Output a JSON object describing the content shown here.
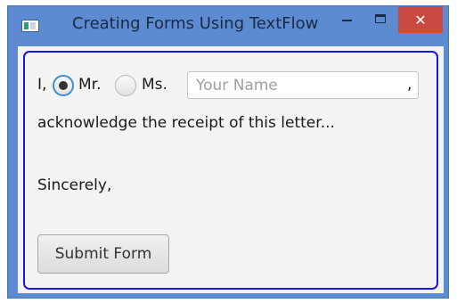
{
  "window": {
    "title": "Creating Forms Using TextFlow",
    "close_label": "✕"
  },
  "form": {
    "prefix": "I,",
    "radio_mr_label": "Mr.",
    "radio_ms_label": "Ms.",
    "selected_option": "Mr.",
    "name_input_value": "",
    "name_input_placeholder": "Your Name",
    "comma": ",",
    "acknowledge_text": "acknowledge the receipt of this letter...",
    "closing_text": "Sincerely,",
    "submit_label": "Submit Form"
  },
  "colors": {
    "titlebar": "#5c8bd1",
    "close_button": "#c94a43",
    "form_border": "#1515e6",
    "radio_selected_ring": "#3b8fcf"
  }
}
